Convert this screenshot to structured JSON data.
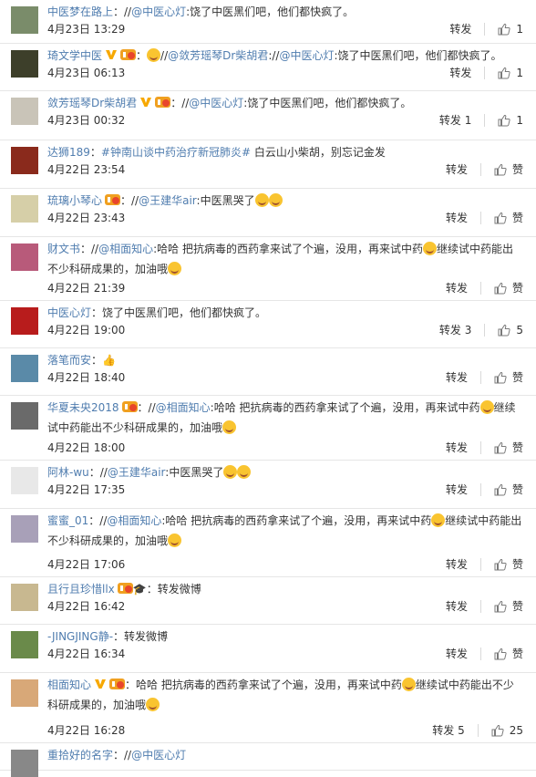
{
  "actions": {
    "repost_label": "转发",
    "like_label": "赞"
  },
  "comments": [
    {
      "user": "中医梦在路上",
      "text_parts": [
        {
          "t": "：//",
          "k": "plain"
        },
        {
          "t": "@中医心灯",
          "k": "mention"
        },
        {
          "t": ":饶了中医黑们吧，他们都快疯了。",
          "k": "plain"
        }
      ],
      "time": "4月23日 13:29",
      "repost": "转发",
      "likes": "1",
      "avatar_color": "#7a8c6a"
    },
    {
      "user": "琦文学中医",
      "text_parts": [
        {
          "t": "：",
          "k": "plain"
        },
        {
          "t": "//",
          "k": "plain"
        },
        {
          "t": "@敛芳瑶琴Dr柴胡君",
          "k": "mention"
        },
        {
          "t": ":",
          "k": "plain"
        },
        {
          "t": "//",
          "k": "plain"
        },
        {
          "t": "@中医心灯",
          "k": "mention"
        },
        {
          "t": ":饶了中医黑们吧，他们都快疯了。",
          "k": "plain"
        }
      ],
      "time": "4月23日 06:13",
      "repost": "转发",
      "likes": "1",
      "avatar_color": "#3d3f2a"
    },
    {
      "user": "敛芳瑶琴Dr柴胡君",
      "text_parts": [
        {
          "t": "：//",
          "k": "plain"
        },
        {
          "t": "@中医心灯",
          "k": "mention"
        },
        {
          "t": ":饶了中医黑们吧，他们都快疯了。",
          "k": "plain"
        }
      ],
      "time": "4月23日 00:32",
      "repost": "转发 1",
      "likes": "1",
      "avatar_color": "#c9c4b8"
    },
    {
      "user": "达狮189",
      "text_parts": [
        {
          "t": "：",
          "k": "plain"
        },
        {
          "t": "#钟南山谈中药治疗新冠肺炎#",
          "k": "mention"
        },
        {
          "t": " 白云山小柴胡，别忘记金发",
          "k": "plain"
        }
      ],
      "time": "4月22日 23:54",
      "repost": "转发",
      "likes": "赞",
      "avatar_color": "#8a2a1c"
    },
    {
      "user": "琉璃小琴心",
      "text_parts": [
        {
          "t": "：//",
          "k": "plain"
        },
        {
          "t": "@王建华air",
          "k": "mention"
        },
        {
          "t": ":中医黑哭了",
          "k": "plain"
        }
      ],
      "time": "4月22日 23:43",
      "repost": "转发",
      "likes": "赞",
      "avatar_color": "#d6cfa8"
    },
    {
      "user": "财文书",
      "text_parts": [
        {
          "t": "：//",
          "k": "plain"
        },
        {
          "t": "@相面知心",
          "k": "mention"
        },
        {
          "t": ":哈哈  把抗病毒的西药拿来试了个遍，没用，再来试中药",
          "k": "plain"
        },
        {
          "t": "继续试中药能出不少科研成果的，加油哦",
          "k": "plain"
        }
      ],
      "time": "4月22日 21:39",
      "repost": "转发",
      "likes": "赞",
      "avatar_color": "#b85a7a"
    },
    {
      "user": "中医心灯",
      "text_parts": [
        {
          "t": "：饶了中医黑们吧，他们都快疯了。",
          "k": "plain"
        }
      ],
      "time": "4月22日 19:00",
      "repost": "转发 3",
      "likes": "5",
      "avatar_color": "#b81c1c"
    },
    {
      "user": "落笔而安",
      "text_parts": [
        {
          "t": "：",
          "k": "plain"
        }
      ],
      "time": "4月22日 18:40",
      "repost": "转发",
      "likes": "赞",
      "avatar_color": "#5a8aa8"
    },
    {
      "user": "华夏未央2018",
      "text_parts": [
        {
          "t": "：//",
          "k": "plain"
        },
        {
          "t": "@相面知心",
          "k": "mention"
        },
        {
          "t": ":哈哈  把抗病毒的西药拿来试了个遍，没用，再来试中药",
          "k": "plain"
        },
        {
          "t": "继续试中药能出不少科研成果的，加油哦",
          "k": "plain"
        }
      ],
      "time": "4月22日 18:00",
      "repost": "转发",
      "likes": "赞",
      "avatar_color": "#6a6a6a"
    },
    {
      "user": "阿林-wu",
      "text_parts": [
        {
          "t": "：//",
          "k": "plain"
        },
        {
          "t": "@王建华air",
          "k": "mention"
        },
        {
          "t": ":中医黑哭了",
          "k": "plain"
        }
      ],
      "time": "4月22日 17:35",
      "repost": "转发",
      "likes": "赞",
      "avatar_color": "#e8e8e8"
    },
    {
      "user": "蜜蜜_01",
      "text_parts": [
        {
          "t": "：//",
          "k": "plain"
        },
        {
          "t": "@相面知心",
          "k": "mention"
        },
        {
          "t": ":哈哈  把抗病毒的西药拿来试了个遍，没用，再来试中药",
          "k": "plain"
        },
        {
          "t": "继续试中药能出不少科研成果的，加油哦",
          "k": "plain"
        }
      ],
      "time": "4月22日 17:06",
      "repost": "转发",
      "likes": "赞",
      "avatar_color": "#a8a0b8"
    },
    {
      "user": "且行且珍惜llx",
      "text_parts": [
        {
          "t": "：转发微博",
          "k": "plain"
        }
      ],
      "time": "4月22日 16:42",
      "repost": "转发",
      "likes": "赞",
      "avatar_color": "#c8b890"
    },
    {
      "user": "-JINGJING静-",
      "text_parts": [
        {
          "t": "：转发微博",
          "k": "plain"
        }
      ],
      "time": "4月22日 16:34",
      "repost": "转发",
      "likes": "赞",
      "avatar_color": "#6a8a4a"
    },
    {
      "user": "相面知心",
      "text_parts": [
        {
          "t": "：哈哈  把抗病毒的西药拿来试了个遍，没用，再来试中药",
          "k": "plain"
        },
        {
          "t": "继续试中药能出不少科研成果的，加油哦",
          "k": "plain"
        }
      ],
      "time": "4月22日 16:28",
      "repost": "转发 5",
      "likes": "25",
      "avatar_color": "#d8a878"
    },
    {
      "user": "重拾好的名字",
      "text_parts": [
        {
          "t": "：//",
          "k": "plain"
        },
        {
          "t": "@中医心灯",
          "k": "mention"
        }
      ],
      "time": "",
      "repost": "",
      "likes": "",
      "avatar_color": "#888888"
    }
  ]
}
